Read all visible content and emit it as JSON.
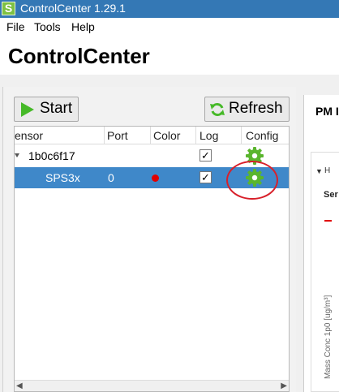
{
  "window": {
    "title": "ControlCenter 1.29.1",
    "icon_letter": "S"
  },
  "menu": [
    {
      "label": "File"
    },
    {
      "label": "Tools"
    },
    {
      "label": "Help"
    }
  ],
  "header": {
    "title": "ControlCenter"
  },
  "toolbar": {
    "start_label": "Start",
    "refresh_label": "Refresh"
  },
  "table": {
    "columns": [
      "ensor",
      "Port",
      "Color",
      "Log",
      "Config"
    ],
    "rows": [
      {
        "name": "1b0c6f17",
        "port": "",
        "log_checked": "✓"
      },
      {
        "name": "SPS3x",
        "port": "0",
        "log_checked": "✓"
      }
    ]
  },
  "right_panel": {
    "tab_label": "PM I",
    "collapse_label": "H",
    "series_label": "Ser",
    "y_axis_label": "Mass Conc 1p0 [ug/m³]"
  },
  "colors": {
    "selected_row": "#3f88c9",
    "gear": "#5ab52e",
    "highlight": "#d8202a",
    "dot": "#e00000"
  }
}
